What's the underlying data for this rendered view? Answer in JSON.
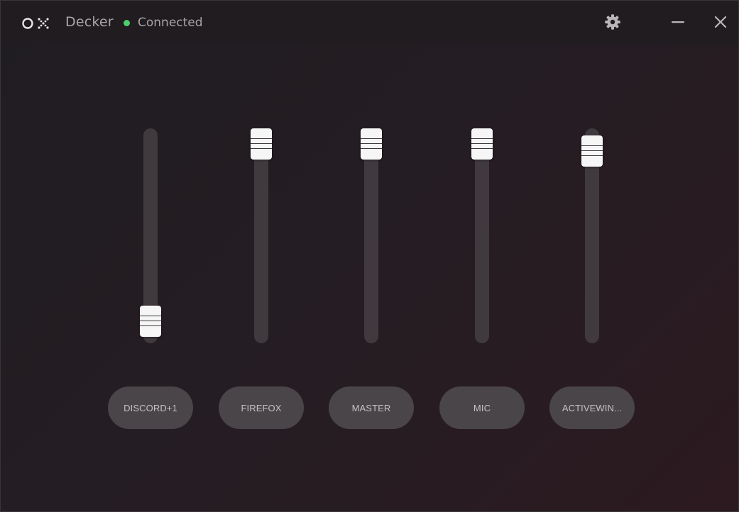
{
  "app": {
    "title": "Decker",
    "status_text": "Connected",
    "status_color": "#4ccf6a",
    "logo_icon": "circle-x-logo-icon"
  },
  "titlebar": {
    "settings_icon": "gear-icon",
    "minimize_icon": "minimize-icon",
    "close_icon": "close-icon"
  },
  "colors": {
    "track": "#403a3f",
    "thumb": "#f7f6f7",
    "pill": "#4a4549",
    "pill_text": "#c4c1c5"
  },
  "channels": [
    {
      "label": "DISCORD+1",
      "level": 0.0
    },
    {
      "label": "FIREFOX",
      "level": 1.0
    },
    {
      "label": "MASTER",
      "level": 1.0
    },
    {
      "label": "MIC",
      "level": 1.0
    },
    {
      "label": "ACTIVEWIN...",
      "level": 0.96
    }
  ]
}
